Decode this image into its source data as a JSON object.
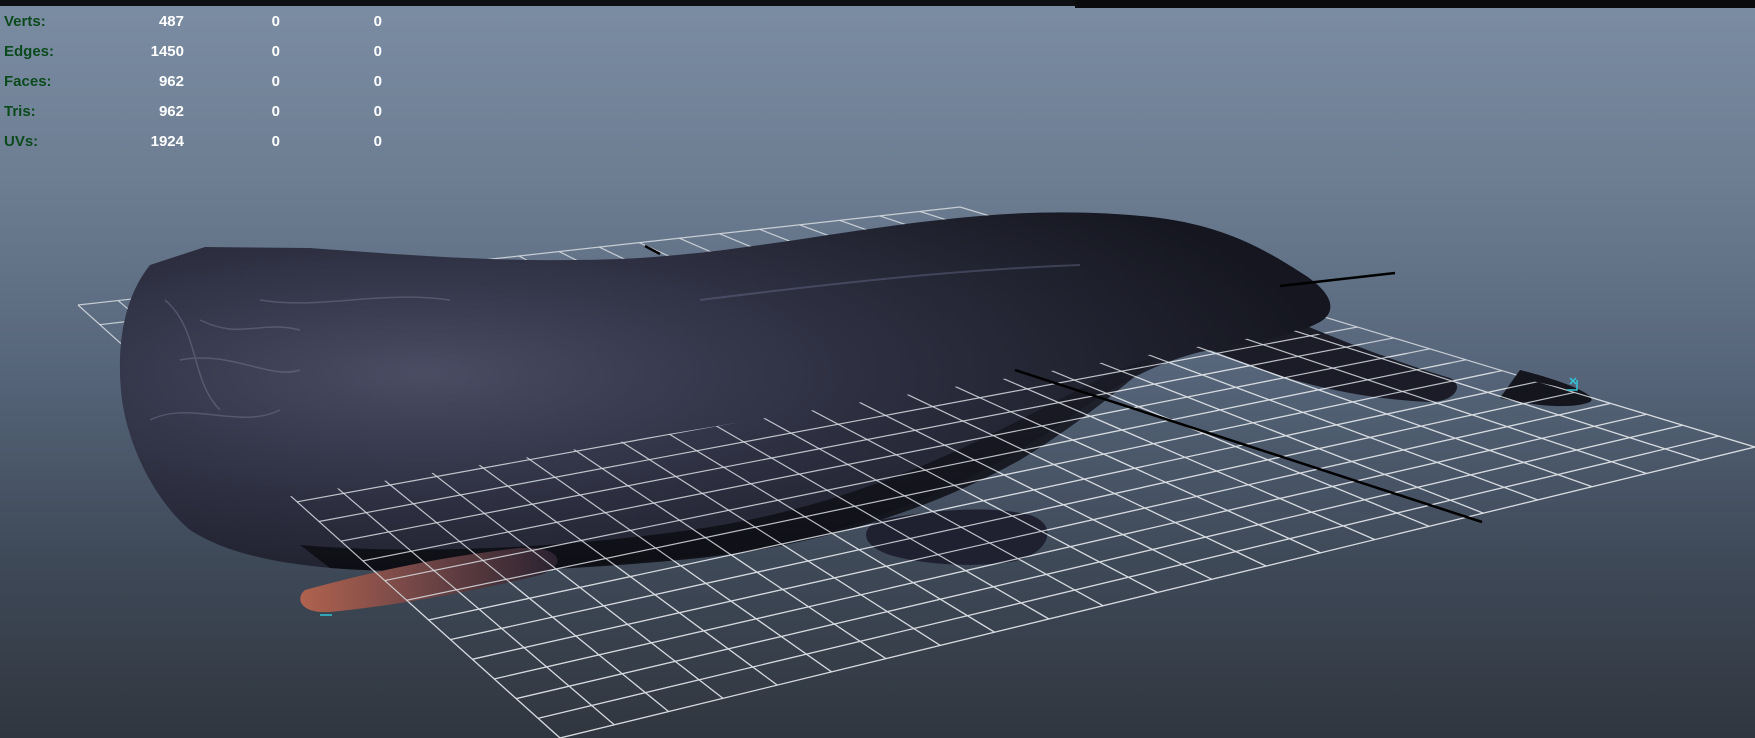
{
  "heads_up_display": {
    "rows": [
      {
        "label": "Verts:",
        "values": [
          "487",
          "0",
          "0"
        ]
      },
      {
        "label": "Edges:",
        "values": [
          "1450",
          "0",
          "0"
        ]
      },
      {
        "label": "Faces:",
        "values": [
          "962",
          "0",
          "0"
        ]
      },
      {
        "label": "Tris:",
        "values": [
          "962",
          "0",
          "0"
        ]
      },
      {
        "label": "UVs:",
        "values": [
          "1924",
          "0",
          "0"
        ]
      }
    ]
  },
  "colors": {
    "viewport_top": "#7b8da3",
    "viewport_bottom": "#30363f",
    "hud_label": "#0b4a1c",
    "hud_value": "#ffffff",
    "grid_line": "#d9dde2",
    "grid_axis": "#000000",
    "model_body": "#2a2c3a",
    "fin_accent": "#b0624e",
    "selection_marker": "#33c6d8"
  },
  "scene": {
    "model": "sperm-whale mesh",
    "grid": "ground-plane grid",
    "icons": [
      "pivot-marker-icon"
    ]
  }
}
